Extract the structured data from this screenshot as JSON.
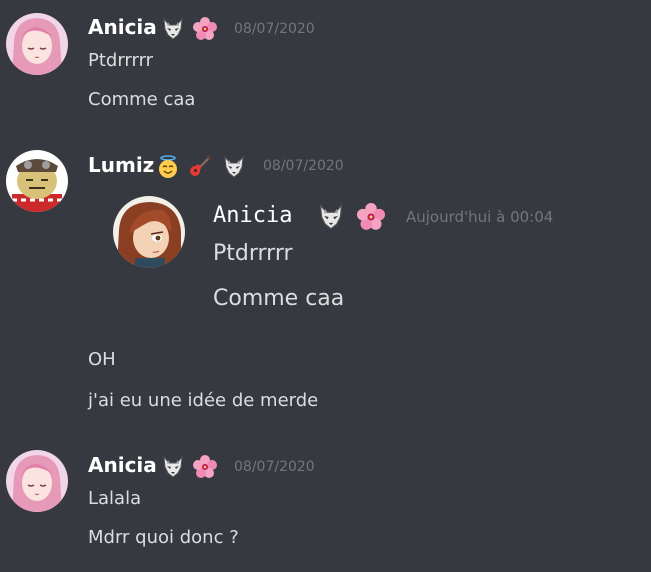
{
  "messages": [
    {
      "username": "Anicia",
      "badges": [
        "wolf-emoji",
        "hibiscus-emoji"
      ],
      "timestamp": "08/07/2020",
      "lines": [
        "Ptdrrrrr",
        "Comme caa"
      ]
    },
    {
      "username": "Lumiz",
      "badges": [
        "angel-face-emoji",
        "guitar-emoji",
        "wolf-emoji"
      ],
      "timestamp": "08/07/2020",
      "quote": {
        "username": "Anicia",
        "badges": [
          "wolf-emoji",
          "hibiscus-emoji"
        ],
        "timestamp": "Aujourd'hui à 00:04",
        "lines": [
          "Ptdrrrrr",
          "Comme caa"
        ]
      },
      "lines": [
        "OH",
        "j'ai eu une idée de merde"
      ]
    },
    {
      "username": "Anicia",
      "badges": [
        "wolf-emoji",
        "hibiscus-emoji"
      ],
      "timestamp": "08/07/2020",
      "lines": [
        "Lalala",
        "Mdrr quoi donc ?"
      ]
    }
  ],
  "colors": {
    "background": "#36393f",
    "username": "#ffffff",
    "text": "#dcddde",
    "timestamp": "#72767d"
  }
}
